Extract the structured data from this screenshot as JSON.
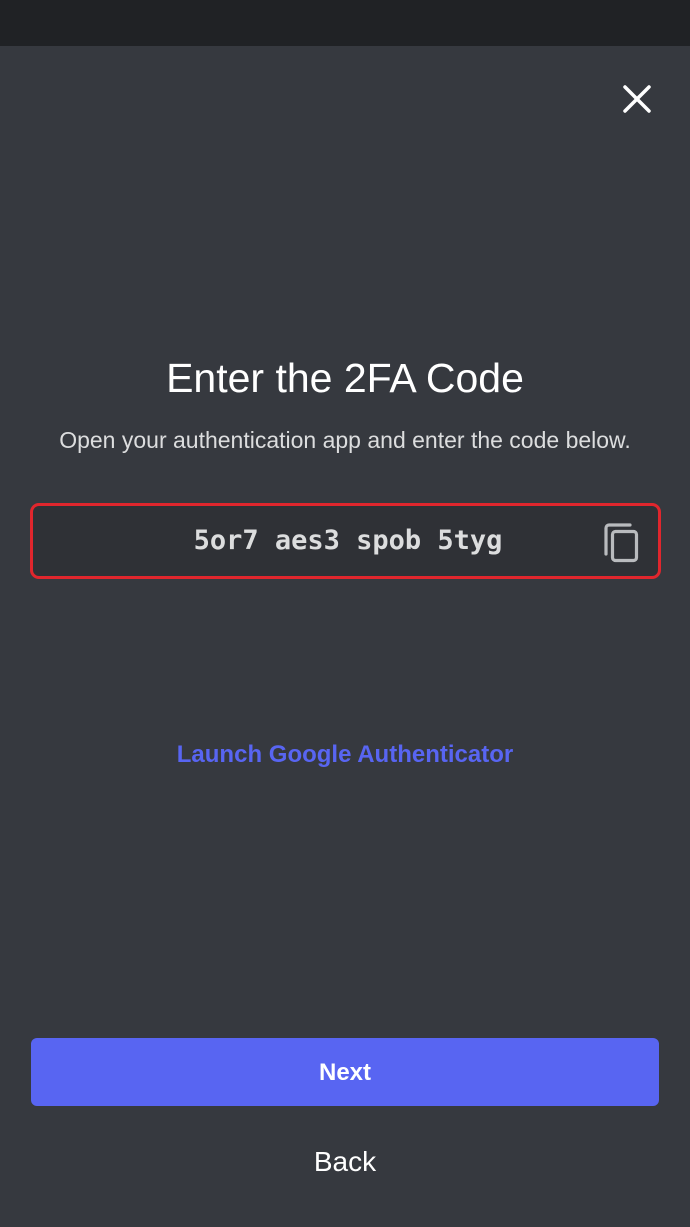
{
  "header": {
    "close_icon": "close-icon"
  },
  "main": {
    "title": "Enter the 2FA Code",
    "subtitle": "Open your authentication app and enter the code below.",
    "code": "5or7 aes3 spob 5tyg",
    "copy_icon": "copy-icon",
    "launch_link": "Launch Google Authenticator"
  },
  "footer": {
    "next_label": "Next",
    "back_label": "Back"
  },
  "colors": {
    "background": "#36393f",
    "accent": "#5865f2",
    "highlight_border": "#e0262d",
    "code_box_bg": "#2f3136"
  }
}
